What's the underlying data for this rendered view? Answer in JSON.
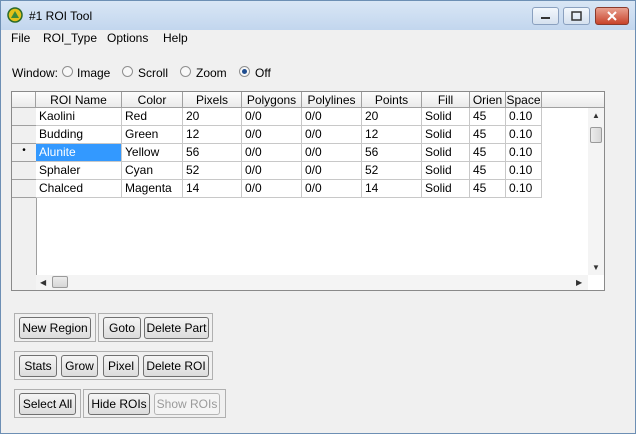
{
  "titlebar": {
    "title": "#1 ROI Tool"
  },
  "menu": {
    "file": "File",
    "roi_type": "ROI_Type",
    "options": "Options",
    "help": "Help"
  },
  "window_select": {
    "label": "Window:",
    "options": [
      "Image",
      "Scroll",
      "Zoom",
      "Off"
    ],
    "selected": "Off"
  },
  "table": {
    "columns": [
      "ROI Name",
      "Color",
      "Pixels",
      "Polygons",
      "Polylines",
      "Points",
      "Fill",
      "Orien",
      "Space"
    ],
    "rows": [
      [
        "Kaolini",
        "Red",
        "20",
        "0/0",
        "0/0",
        "20",
        "Solid",
        "45",
        "0.10"
      ],
      [
        "Budding",
        "Green",
        "12",
        "0/0",
        "0/0",
        "12",
        "Solid",
        "45",
        "0.10"
      ],
      [
        "Alunite",
        "Yellow",
        "56",
        "0/0",
        "0/0",
        "56",
        "Solid",
        "45",
        "0.10"
      ],
      [
        "Sphaler",
        "Cyan",
        "52",
        "0/0",
        "0/0",
        "52",
        "Solid",
        "45",
        "0.10"
      ],
      [
        "Chalced",
        "Magenta",
        "14",
        "0/0",
        "0/0",
        "14",
        "Solid",
        "45",
        "0.10"
      ]
    ],
    "current_row_marker": "•",
    "selected_cell": "Alunite"
  },
  "buttons": {
    "new_region": "New Region",
    "goto": "Goto",
    "delete_part": "Delete Part",
    "stats": "Stats",
    "grow": "Grow",
    "pixel": "Pixel",
    "delete_roi": "Delete ROI",
    "select_all": "Select All",
    "hide_rois": "Hide ROIs",
    "show_rois": "Show ROIs"
  },
  "colors": {
    "selection": "#3399ff",
    "titlebar": "#c2d6ee",
    "close": "#c8432b"
  }
}
